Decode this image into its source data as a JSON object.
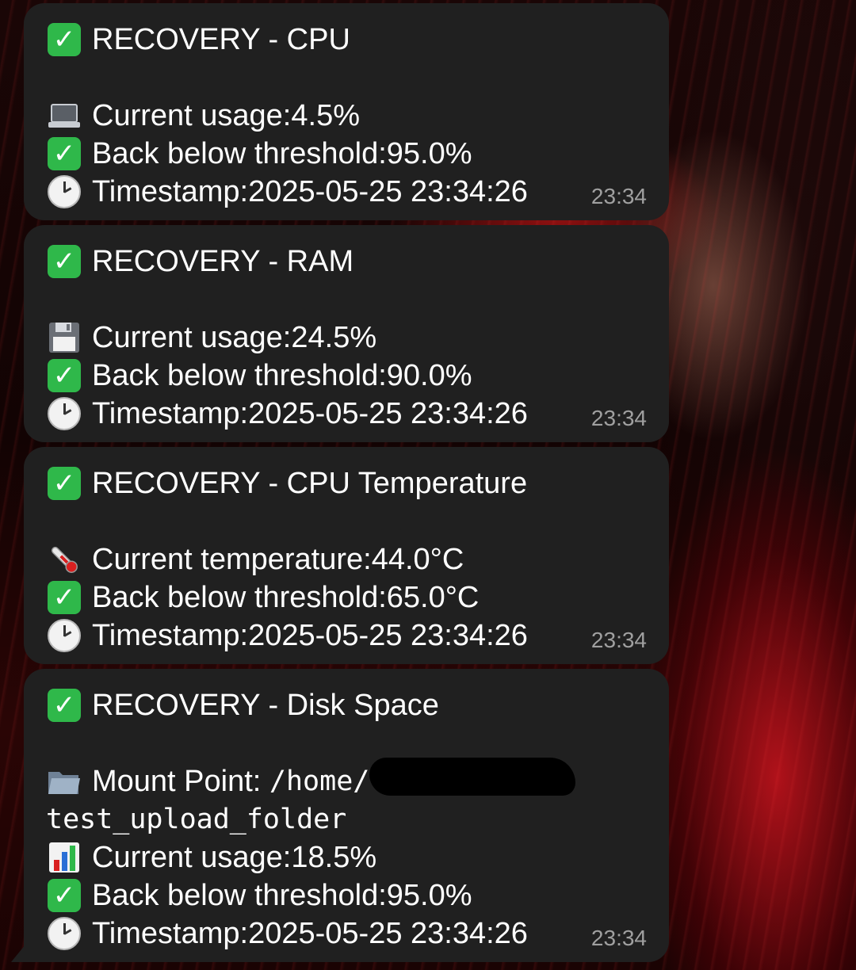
{
  "messages": [
    {
      "title": "RECOVERY - CPU",
      "lines": [
        {
          "icon": "laptop-icon",
          "label": "Current usage:",
          "value": " 4.5%"
        },
        {
          "icon": "check-icon",
          "label": "Back below threshold:",
          "value": " 95.0%"
        },
        {
          "icon": "clock-icon",
          "label": "Timestamp:",
          "value": " 2025-05-25 23:34:26"
        }
      ],
      "time": "23:34"
    },
    {
      "title": "RECOVERY - RAM",
      "lines": [
        {
          "icon": "floppy-disk-icon",
          "label": "Current usage:",
          "value": " 24.5%"
        },
        {
          "icon": "check-icon",
          "label": "Back below threshold:",
          "value": " 90.0%"
        },
        {
          "icon": "clock-icon",
          "label": "Timestamp:",
          "value": " 2025-05-25 23:34:26"
        }
      ],
      "time": "23:34"
    },
    {
      "title": "RECOVERY - CPU Temperature",
      "lines": [
        {
          "icon": "thermometer-icon",
          "label": "Current temperature:",
          "value": " 44.0°C"
        },
        {
          "icon": "check-icon",
          "label": "Back below threshold:",
          "value": " 65.0°C"
        },
        {
          "icon": "clock-icon",
          "label": "Timestamp:",
          "value": " 2025-05-25 23:34:26"
        }
      ],
      "time": "23:34"
    },
    {
      "title": "RECOVERY - Disk Space",
      "mount_label": "Mount Point:",
      "mount_path_start": "/home/",
      "mount_path_end": "test_upload_folder",
      "lines": [
        {
          "icon": "bar-chart-icon",
          "label": "Current usage:",
          "value": " 18.5%"
        },
        {
          "icon": "check-icon",
          "label": "Back below threshold:",
          "value": " 95.0%"
        },
        {
          "icon": "clock-icon",
          "label": "Timestamp:",
          "value": " 2025-05-25 23:34:26"
        }
      ],
      "time": "23:34"
    }
  ],
  "colors": {
    "bubble": "#202020",
    "check": "#2fb84a",
    "time_text": "#a0a0a0"
  }
}
